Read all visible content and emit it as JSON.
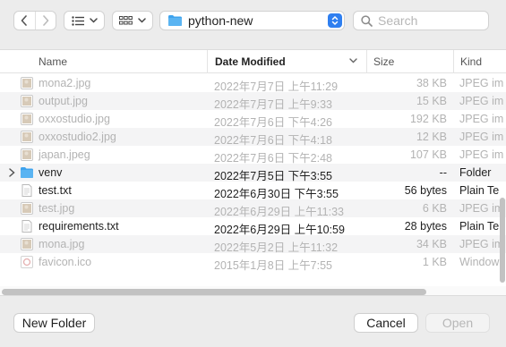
{
  "toolbar": {
    "back_icon": "chevron-left-icon",
    "forward_icon": "chevron-right-icon",
    "list_view_icon": "list-view-icon",
    "grid_view_icon": "grid-view-icon",
    "path": "python-new",
    "search_placeholder": "Search"
  },
  "columns": {
    "name": "Name",
    "date": "Date Modified",
    "size": "Size",
    "kind": "Kind"
  },
  "files": [
    {
      "name": "mona2.jpg",
      "date": "2022年7月7日 上午11:29",
      "size": "38 KB",
      "kind": "JPEG im",
      "icon": "image-file-icon",
      "enabled": false
    },
    {
      "name": "output.jpg",
      "date": "2022年7月7日 上午9:33",
      "size": "15 KB",
      "kind": "JPEG im",
      "icon": "image-file-icon",
      "enabled": false
    },
    {
      "name": "oxxostudio.jpg",
      "date": "2022年7月6日 下午4:26",
      "size": "192 KB",
      "kind": "JPEG im",
      "icon": "image-file-icon",
      "enabled": false
    },
    {
      "name": "oxxostudio2.jpg",
      "date": "2022年7月6日 下午4:18",
      "size": "12 KB",
      "kind": "JPEG im",
      "icon": "image-file-icon",
      "enabled": false
    },
    {
      "name": "japan.jpeg",
      "date": "2022年7月6日 下午2:48",
      "size": "107 KB",
      "kind": "JPEG im",
      "icon": "image-file-icon",
      "enabled": false
    },
    {
      "name": "venv",
      "date": "2022年7月5日 下午3:55",
      "size": "--",
      "kind": "Folder",
      "icon": "folder-icon",
      "enabled": true,
      "expandable": true
    },
    {
      "name": "test.txt",
      "date": "2022年6月30日 下午3:55",
      "size": "56 bytes",
      "kind": "Plain Te",
      "icon": "text-file-icon",
      "enabled": true
    },
    {
      "name": "test.jpg",
      "date": "2022年6月29日 上午11:33",
      "size": "6 KB",
      "kind": "JPEG im",
      "icon": "image-file-icon",
      "enabled": false
    },
    {
      "name": "requirements.txt",
      "date": "2022年6月29日 上午10:59",
      "size": "28 bytes",
      "kind": "Plain Te",
      "icon": "text-file-icon",
      "enabled": true
    },
    {
      "name": "mona.jpg",
      "date": "2022年5月2日 上午11:32",
      "size": "34 KB",
      "kind": "JPEG im",
      "icon": "image-file-icon",
      "enabled": false
    },
    {
      "name": "favicon.ico",
      "date": "2015年1月8日 上午7:55",
      "size": "1 KB",
      "kind": "Window",
      "icon": "ico-file-icon",
      "enabled": false
    }
  ],
  "buttons": {
    "new_folder": "New Folder",
    "cancel": "Cancel",
    "open": "Open"
  },
  "colors": {
    "accent": "#2f7ff0",
    "folder": "#3ea3ee",
    "disabled_text": "#b3b3b3"
  }
}
